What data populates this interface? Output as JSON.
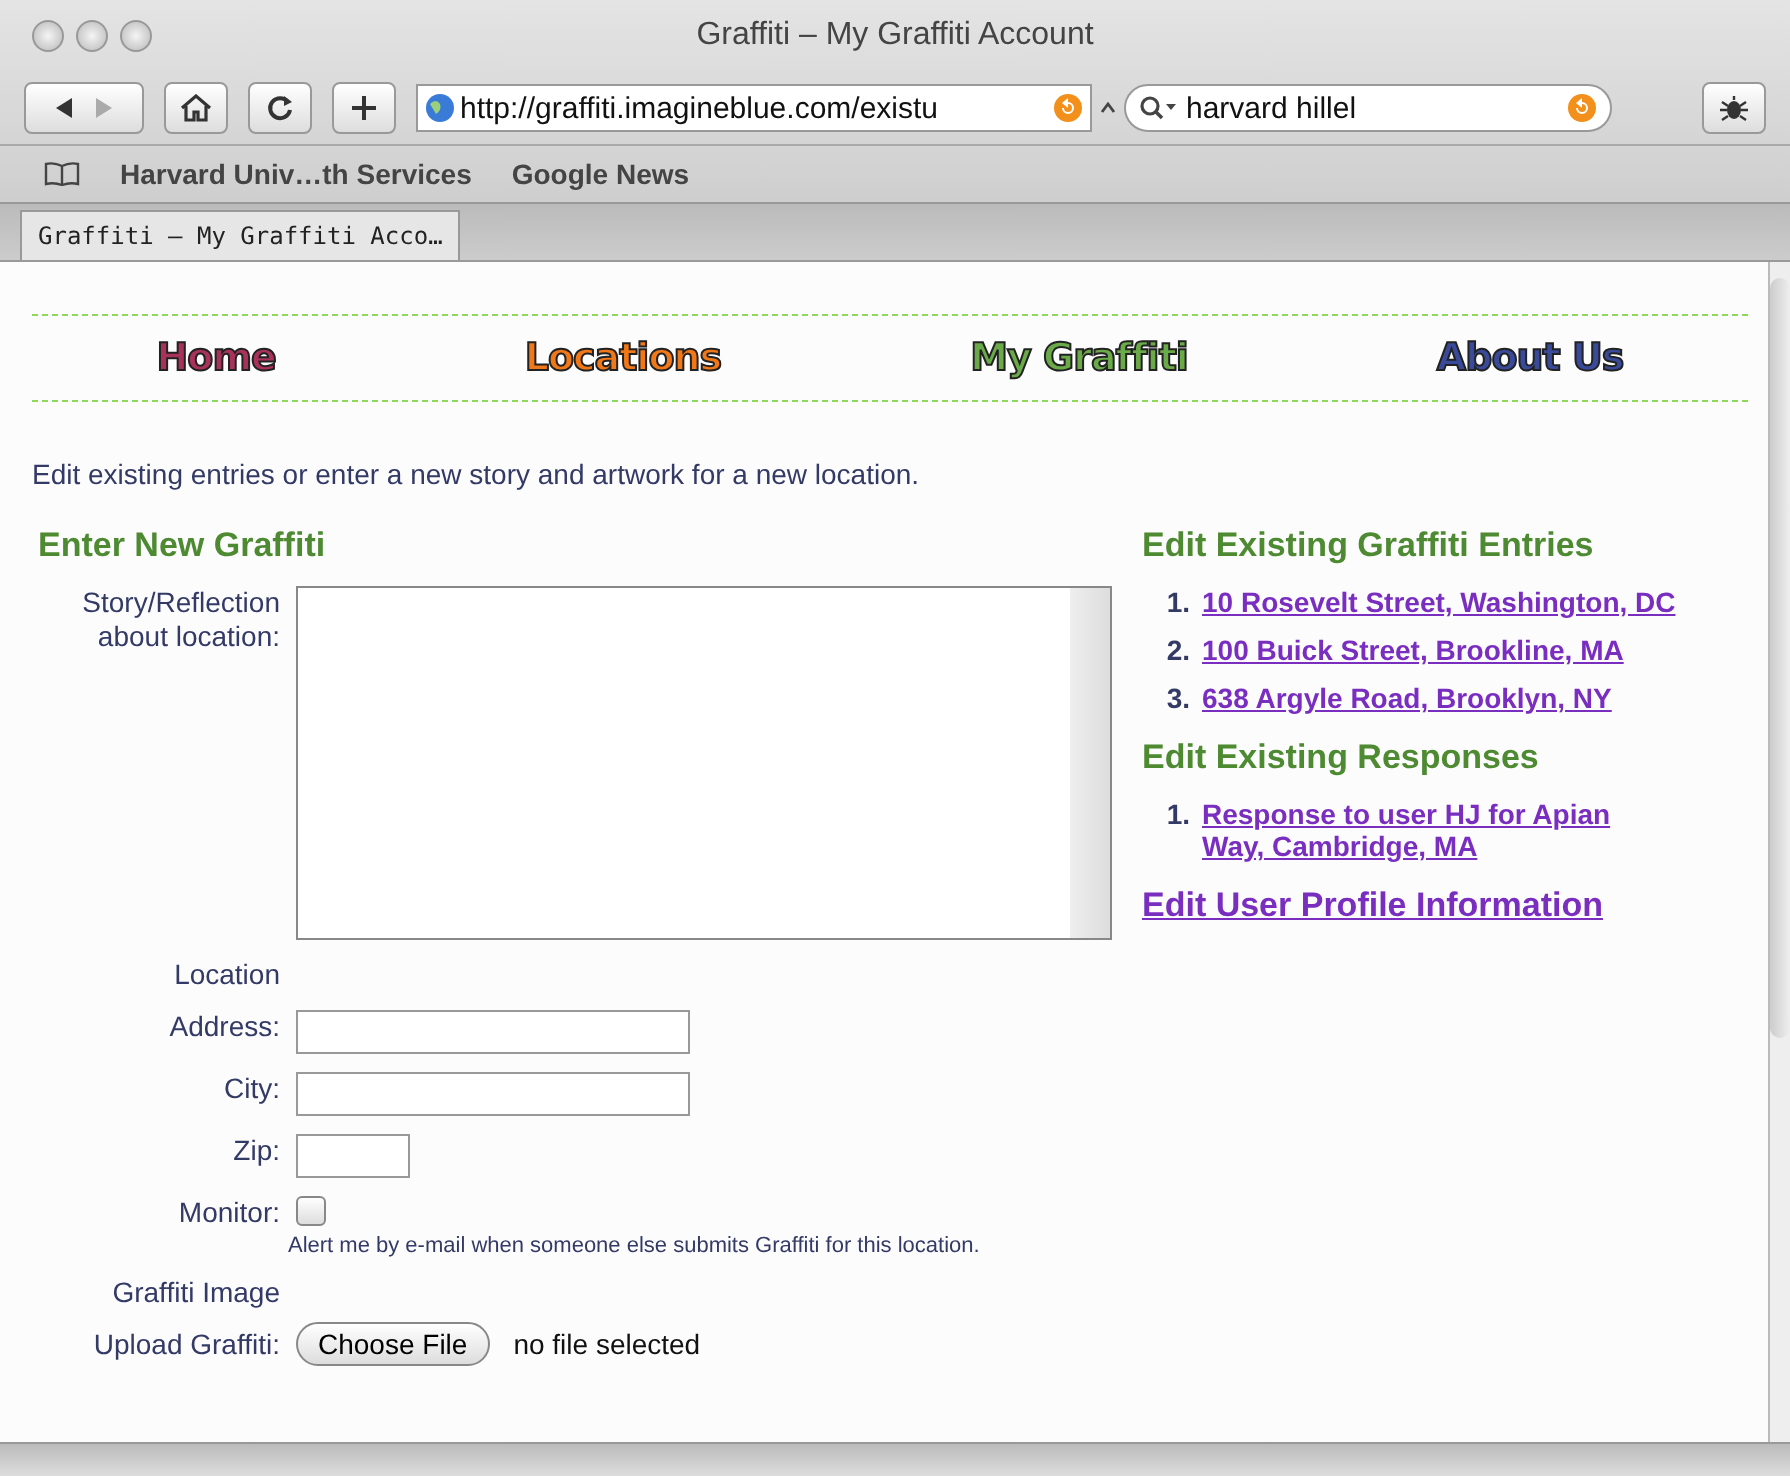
{
  "window": {
    "title": "Graffiti – My Graffiti Account"
  },
  "toolbar": {
    "url": "http://graffiti.imagineblue.com/existu",
    "search": "harvard hillel"
  },
  "bookmarks": [
    "Harvard Univ…th Services",
    "Google News"
  ],
  "tabs": [
    {
      "label": "Graffiti – My Graffiti Acco…",
      "selected": true
    }
  ],
  "nav": [
    {
      "label": "Home",
      "color": "#a8325a"
    },
    {
      "label": "Locations",
      "color": "#f07818"
    },
    {
      "label": "My Graffiti",
      "color": "#6aaa48"
    },
    {
      "label": "About Us",
      "color": "#3a4a9a"
    }
  ],
  "intro": "Edit existing entries or enter a new story and artwork for a new location.",
  "form": {
    "heading": "Enter New Graffiti",
    "story_label": "Story/Reflection about location:",
    "location_heading": "Location",
    "fields": [
      {
        "label": "Address:",
        "kind": "wide"
      },
      {
        "label": "City:",
        "kind": "wide"
      },
      {
        "label": "Zip:",
        "kind": "short"
      }
    ],
    "monitor": {
      "label": "Monitor:",
      "checked": false,
      "note": "Alert me by e-mail when someone else submits Graffiti for this location."
    },
    "image_heading": "Graffiti Image",
    "upload_label": "Upload Graffiti:",
    "upload_button": "Choose File",
    "upload_status": "no file selected"
  },
  "entries": {
    "heading": "Edit Existing Graffiti Entries",
    "items": [
      {
        "number": "1.",
        "label": "10 Rosevelt Street, Washington, DC"
      },
      {
        "number": "2.",
        "label": "100 Buick Street, Brookline, MA"
      },
      {
        "number": "3.",
        "label": "638 Argyle Road, Brooklyn, NY"
      }
    ]
  },
  "responses": {
    "heading": "Edit Existing Responses",
    "items": [
      {
        "number": "1.",
        "label": "Response to user HJ for Apian Way, Cambridge, MA"
      }
    ]
  },
  "profile_link": "Edit User Profile Information"
}
